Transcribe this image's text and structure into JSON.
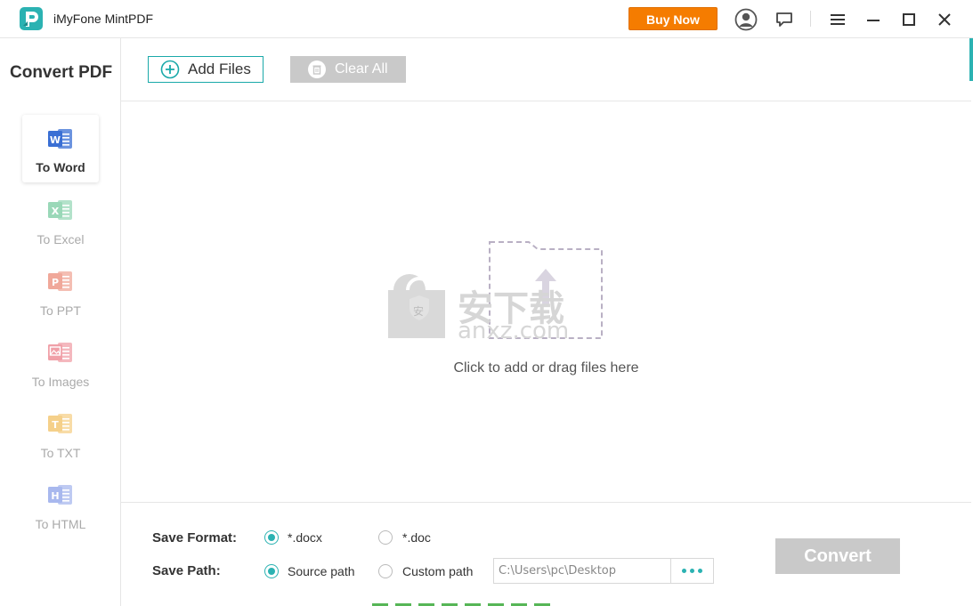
{
  "window": {
    "title": "iMyFone MintPDF",
    "buy_label": "Buy Now",
    "icons": [
      "account-icon",
      "feedback-icon",
      "menu-icon",
      "minimize-icon",
      "maximize-icon",
      "close-icon"
    ]
  },
  "sidebar": {
    "title": "Convert PDF",
    "items": [
      {
        "label": "To Word",
        "icon": "word-icon",
        "letter": "W",
        "color": "#3a6fd4",
        "active": true
      },
      {
        "label": "To Excel",
        "icon": "excel-icon",
        "letter": "X",
        "color": "#9ad8b8",
        "active": false
      },
      {
        "label": "To PPT",
        "icon": "ppt-icon",
        "letter": "P",
        "color": "#f0a89a",
        "active": false
      },
      {
        "label": "To Images",
        "icon": "images-icon",
        "letter": "",
        "color": "#f0a0a8",
        "active": false
      },
      {
        "label": "To TXT",
        "icon": "txt-icon",
        "letter": "T",
        "color": "#f5d08a",
        "active": false
      },
      {
        "label": "To HTML",
        "icon": "html-icon",
        "letter": "H",
        "color": "#a8b8ee",
        "active": false
      }
    ]
  },
  "toolbar": {
    "add_label": "Add Files",
    "clear_label": "Clear All"
  },
  "dropzone": {
    "hint": "Click to add or drag files here",
    "watermark_text": "anxz.com"
  },
  "settings": {
    "format_label": "Save Format:",
    "format_options": [
      {
        "label": "*.docx",
        "selected": true
      },
      {
        "label": "*.doc",
        "selected": false
      }
    ],
    "path_label": "Save Path:",
    "path_options": [
      {
        "label": "Source path",
        "selected": true
      },
      {
        "label": "Custom path",
        "selected": false
      }
    ],
    "custom_path": "C:\\Users\\pc\\Desktop",
    "convert_label": "Convert"
  },
  "colors": {
    "accent": "#2bb2b2",
    "buy": "#f57c00",
    "disabled": "#c9c9c9"
  }
}
